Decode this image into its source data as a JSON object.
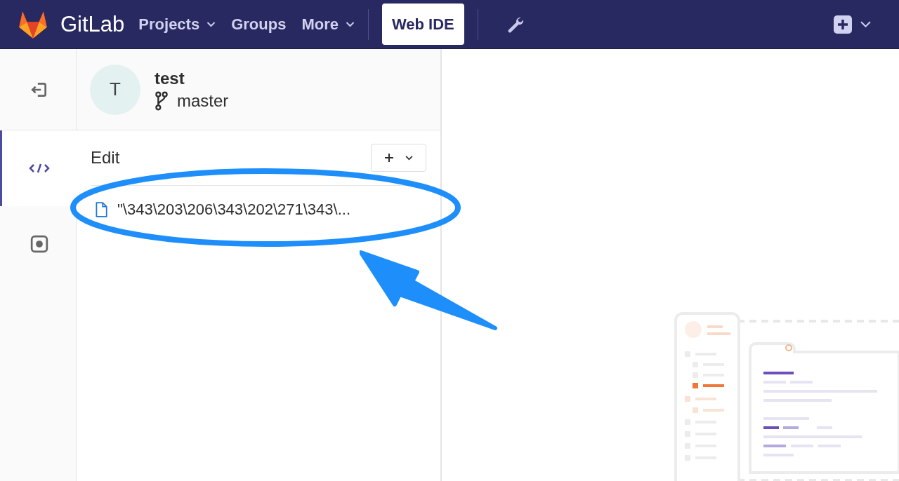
{
  "navbar": {
    "brand": "GitLab",
    "items": [
      {
        "label": "Projects",
        "dropdown": true
      },
      {
        "label": "Groups",
        "dropdown": false
      },
      {
        "label": "More",
        "dropdown": true
      }
    ],
    "web_ide": {
      "label": "Web IDE",
      "selected": true
    }
  },
  "activity_bar": [
    {
      "kind": "edit",
      "selected": true
    },
    {
      "kind": "commit",
      "selected": false
    }
  ],
  "project": {
    "avatar": "T",
    "name": "test",
    "branch": "master"
  },
  "panel": {
    "title": "Edit",
    "files": [
      {
        "name": "\"\\343\\203\\206\\343\\202\\271\\343\\..."
      }
    ]
  }
}
